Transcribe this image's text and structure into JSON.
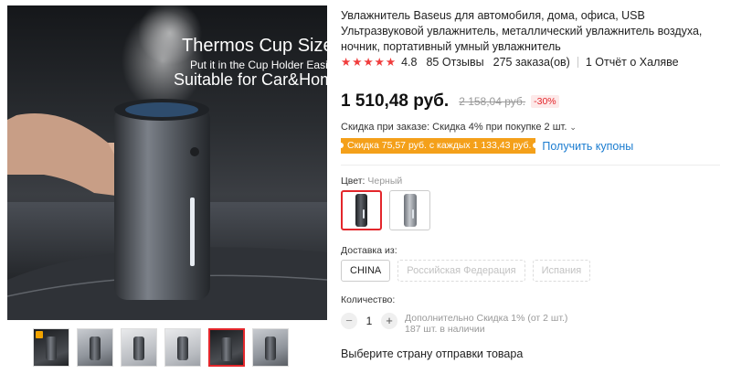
{
  "gallery": {
    "overlay_line1": "Thermos Cup Size",
    "overlay_line2": "Put it in the Cup Holder Easily",
    "overlay_line3": "Suitable for Car&Home",
    "thumbnails": [
      {
        "style": "dark",
        "active": false
      },
      {
        "style": "grey",
        "active": false
      },
      {
        "style": "light",
        "active": false
      },
      {
        "style": "light",
        "active": false
      },
      {
        "style": "dark",
        "active": true
      },
      {
        "style": "grey",
        "active": false
      }
    ]
  },
  "product": {
    "title": "Увлажнитель Baseus для автомобиля, дома, офиса, USB Ультразвуковой увлажнитель, металлический увлажнитель воздуха, ночник, портативный умный увлажнитель",
    "rating": "4.8",
    "stars": 5,
    "reviews": "85 Отзывы",
    "orders": "275 заказа(ов)",
    "reports": "1 Отчёт о Халяве"
  },
  "pricing": {
    "price": "1 510,48 руб.",
    "old_price": "2 158,04 руб.",
    "discount": "-30%",
    "bulk_discount": "Скидка при заказе: Скидка 4% при покупке 2 шт.",
    "coupon": "Скидка 75,57 руб. с каждых 1 133,43 руб.",
    "coupon_link": "Получить купоны"
  },
  "color": {
    "label": "Цвет:",
    "selected": "Черный",
    "options": [
      "Черный",
      "Серый"
    ]
  },
  "shipping": {
    "label": "Доставка из:",
    "options": [
      {
        "label": "CHINA",
        "enabled": true
      },
      {
        "label": "Российская Федерация",
        "enabled": false
      },
      {
        "label": "Испания",
        "enabled": false
      }
    ],
    "ship_from_prompt": "Выберите страну отправки товара"
  },
  "quantity": {
    "label": "Количество:",
    "value": "1",
    "minus": "−",
    "plus": "+",
    "extra_discount": "Дополнительно Скидка 1% (от 2 шт.)",
    "stock": "187 шт. в наличии"
  },
  "colors": {
    "accent": "#e3262b",
    "star": "#f03d3d",
    "coupon_bg": "#f4a01a",
    "link": "#1a7cd0"
  }
}
